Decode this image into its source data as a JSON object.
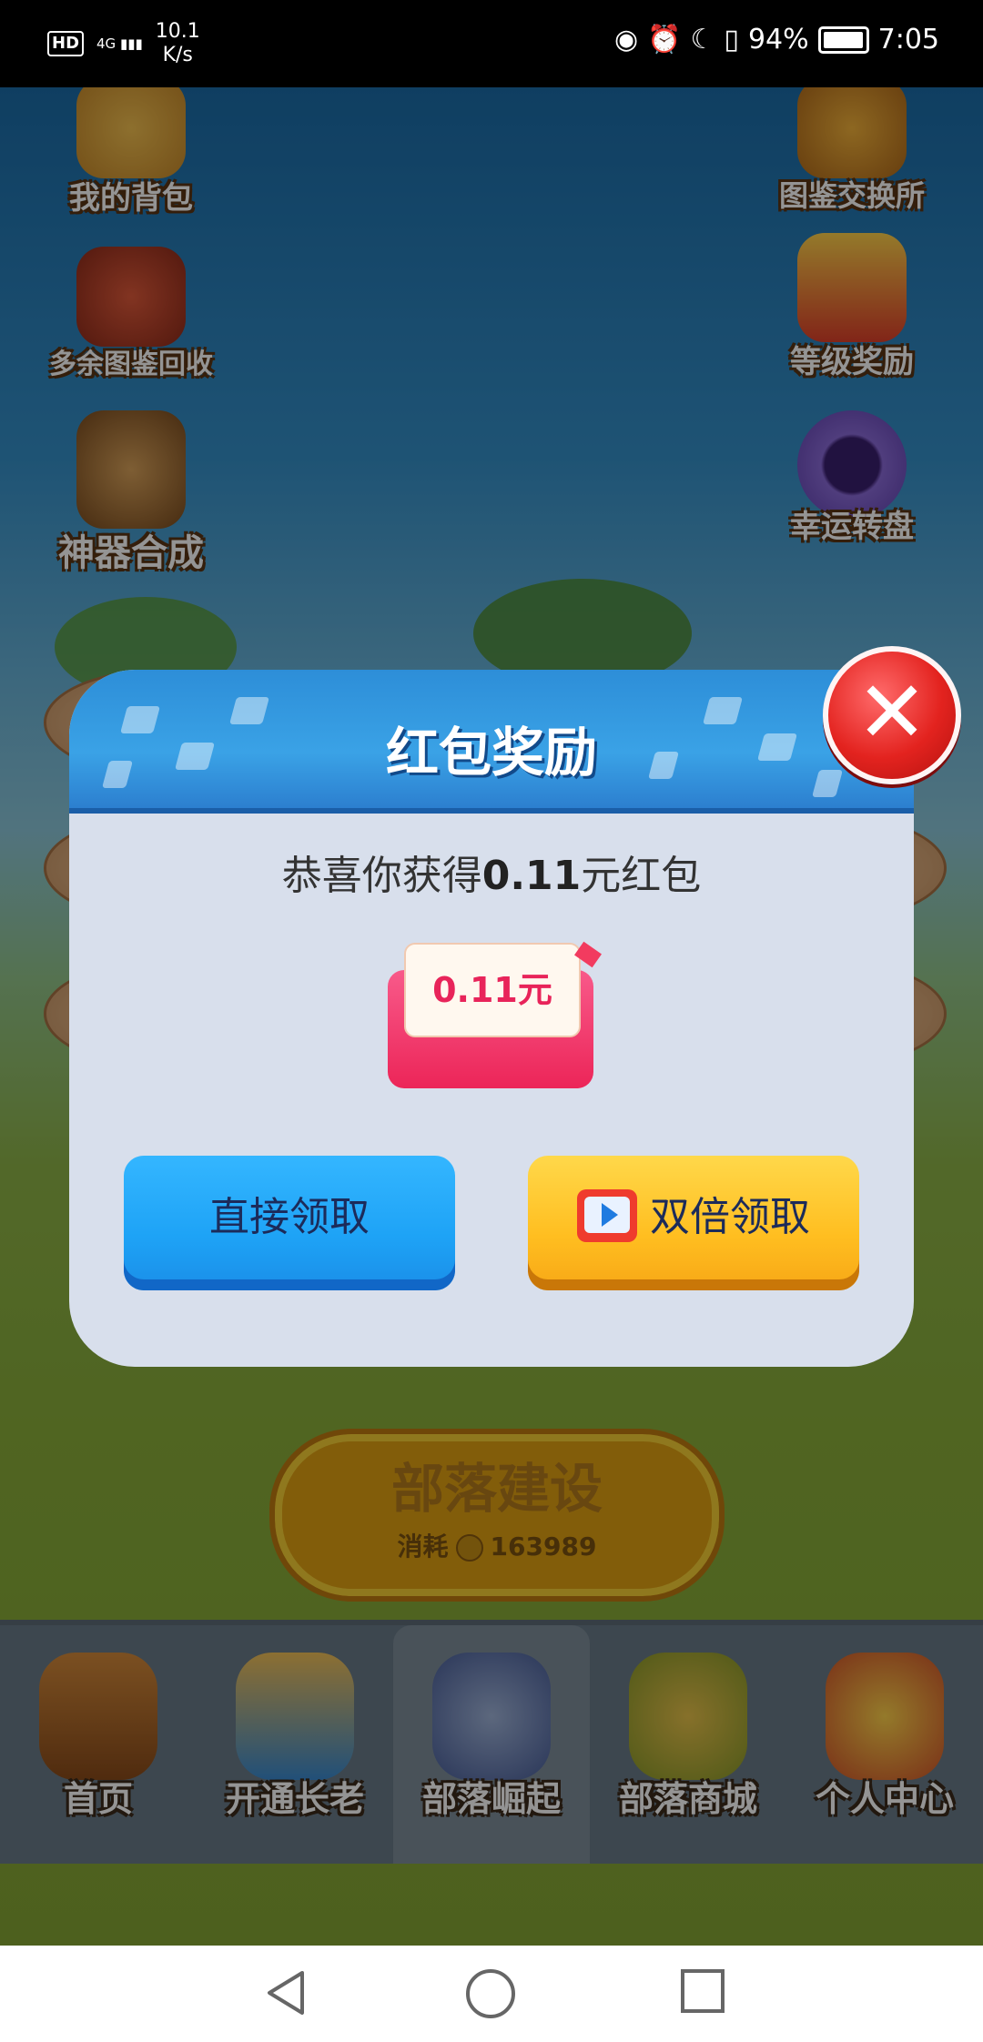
{
  "status_bar": {
    "hd_label": "HD",
    "network": "4G",
    "speed": "10.1\nK/s",
    "speed_value": "10.1",
    "speed_unit": "K/s",
    "battery_percent": "94%",
    "time": "7:05",
    "icons": [
      "eye-icon",
      "alarm-icon",
      "moon-icon",
      "vibrate-icon",
      "battery-icon"
    ]
  },
  "game": {
    "side_left": [
      {
        "label": "我的背包",
        "icon": "backpack-icon"
      },
      {
        "label": "多余图鉴回收",
        "icon": "book-recycle-icon"
      },
      {
        "label": "神器合成",
        "icon": "artifact-icon"
      }
    ],
    "side_right": [
      {
        "label": "图鉴交换所",
        "icon": "exchange-icon"
      },
      {
        "label": "等级奖励",
        "icon": "gift-icon"
      },
      {
        "label": "幸运转盘",
        "icon": "wheel-icon"
      }
    ],
    "build_button": {
      "label": "部落建设",
      "cost_label": "消耗",
      "cost_value": "163989"
    },
    "bottom_nav": [
      {
        "label": "首页",
        "icon": "totem-icon",
        "active": false
      },
      {
        "label": "开通长老",
        "icon": "elder-icon",
        "active": false
      },
      {
        "label": "部落崛起",
        "icon": "egg-icon",
        "active": true
      },
      {
        "label": "部落商城",
        "icon": "shop-icon",
        "active": false
      },
      {
        "label": "个人中心",
        "icon": "profile-icon",
        "active": false
      }
    ]
  },
  "dialog": {
    "title": "红包奖励",
    "message_prefix": "恭喜你获得",
    "message_amount": "0.11",
    "message_suffix": "元红包",
    "envelope_amount": "0.11元",
    "btn_direct": "直接领取",
    "btn_double": "双倍领取",
    "close_icon": "close-icon",
    "colors": {
      "primary_blue": "#1ea3f6",
      "gold": "#ffbe20",
      "red": "#e3231f"
    }
  },
  "nav_bar": {
    "icons": [
      "back-icon",
      "home-icon",
      "recents-icon"
    ]
  }
}
